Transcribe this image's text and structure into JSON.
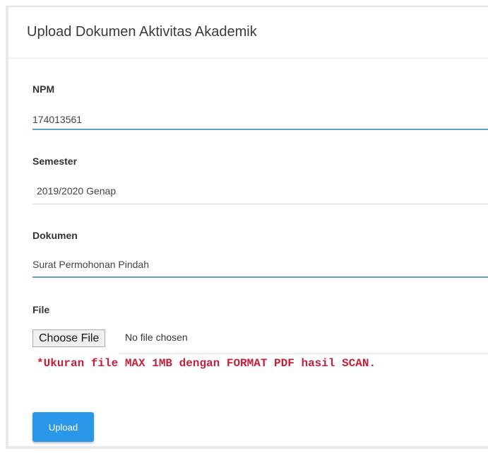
{
  "header": {
    "title": "Upload Dokumen Aktivitas Akademik"
  },
  "form": {
    "npm": {
      "label": "NPM",
      "value": "174013561"
    },
    "semester": {
      "label": "Semester",
      "value": "2019/2020 Genap"
    },
    "dokumen": {
      "label": "Dokumen",
      "value": "Surat Permohonan Pindah"
    },
    "file": {
      "label": "File",
      "button_label": "Choose File",
      "status": "No file chosen",
      "notice": "*Ukuran file MAX 1MB dengan FORMAT PDF hasil SCAN."
    },
    "submit_label": "Upload"
  },
  "colors": {
    "accent": "#2b97e8",
    "field_active_underline": "#5fa6bf",
    "notice": "#c4203a"
  }
}
